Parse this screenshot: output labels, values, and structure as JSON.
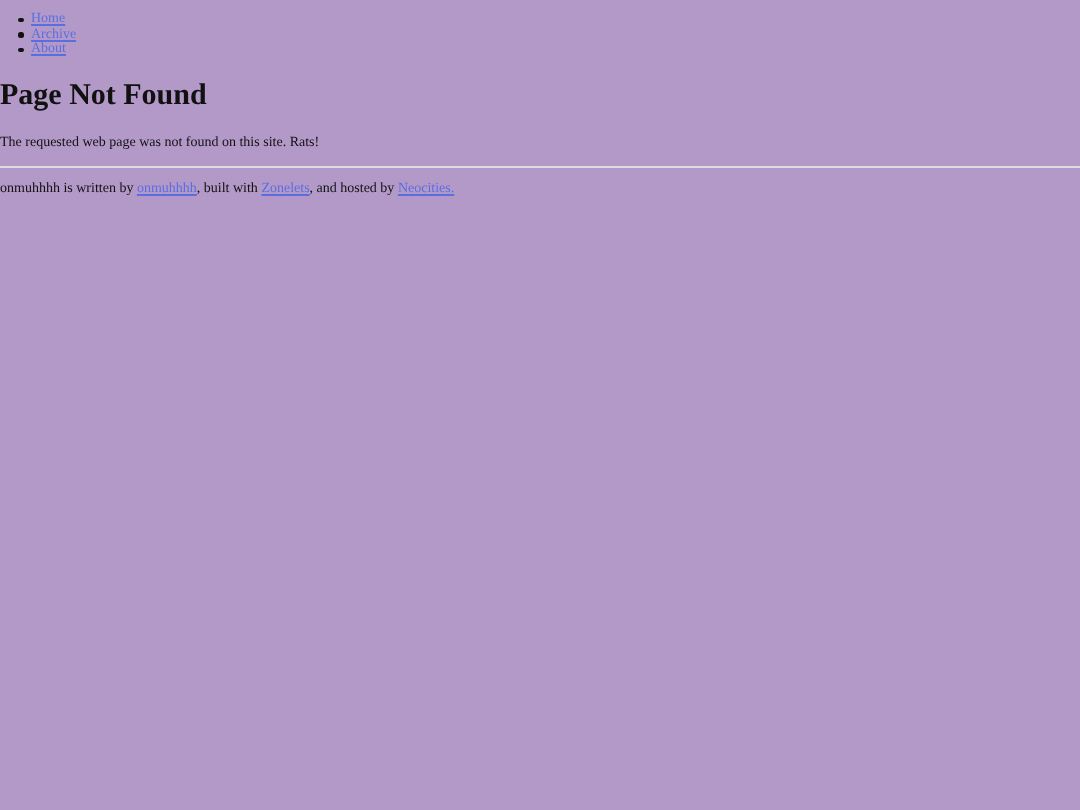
{
  "nav": [
    {
      "label": "Home"
    },
    {
      "label": "Archive"
    },
    {
      "label": "About"
    }
  ],
  "heading": "Page Not Found",
  "message": "The requested web page was not found on this site. Rats!",
  "footer": [
    {
      "kind": "text",
      "text": "onmuhhhh is written by "
    },
    {
      "kind": "link",
      "text": "onmuhhhh"
    },
    {
      "kind": "text",
      "text": ", built with "
    },
    {
      "kind": "link",
      "text": "Zonelets"
    },
    {
      "kind": "text",
      "text": ", and hosted by "
    },
    {
      "kind": "link",
      "text": "Neocities."
    }
  ]
}
